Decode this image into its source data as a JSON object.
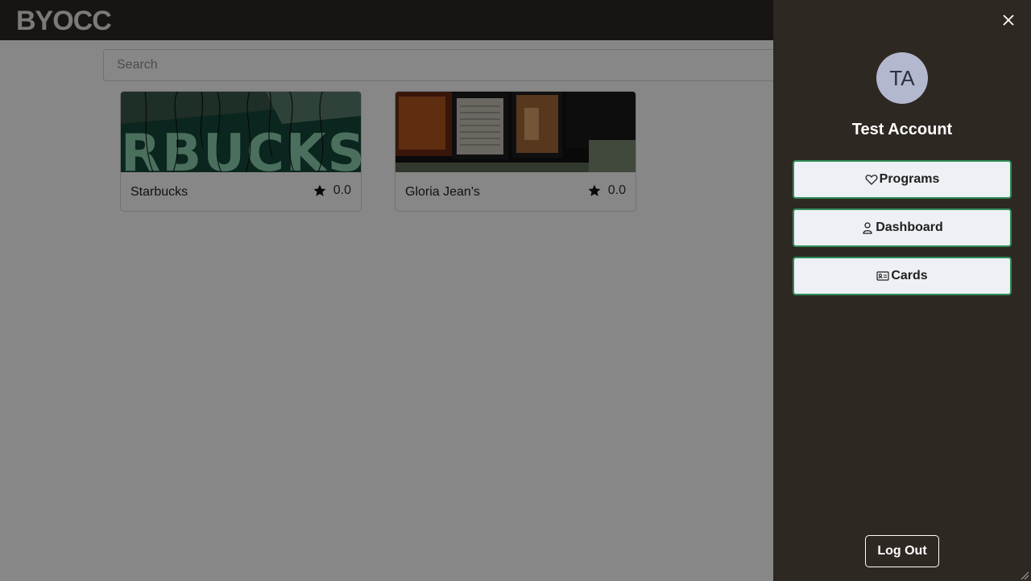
{
  "header": {
    "brand": "BYOCC"
  },
  "search": {
    "placeholder": "Search",
    "value": ""
  },
  "stores": [
    {
      "name": "Starbucks",
      "rating": "0.0",
      "image_icon": "starbucks-sign-photo"
    },
    {
      "name": "Gloria Jean's",
      "rating": "0.0",
      "image_icon": "menu-board-photo"
    }
  ],
  "sidebar": {
    "avatar_initials": "TA",
    "user_name": "Test Account",
    "menu": [
      {
        "label": "Programs",
        "icon": "heart-icon"
      },
      {
        "label": "Dashboard",
        "icon": "person-icon"
      },
      {
        "label": "Cards",
        "icon": "id-card-icon"
      }
    ],
    "logout_label": "Log Out",
    "close_icon": "close-icon"
  },
  "colors": {
    "navbar": "#2e2620",
    "sidebar_bg": "#2e2822",
    "button_border": "#2e8b57",
    "button_bg": "#edf1f5",
    "avatar_bg": "#b3b8cf"
  }
}
